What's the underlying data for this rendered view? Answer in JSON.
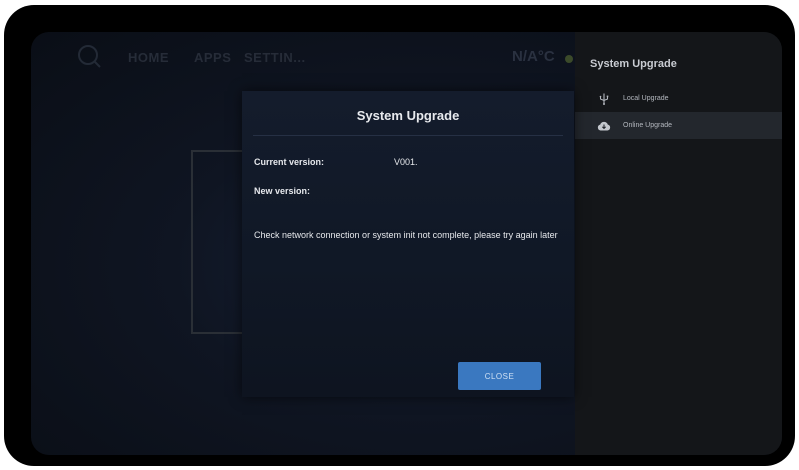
{
  "topbar": {
    "nav": [
      "HOME",
      "APPS",
      "SETTIN..."
    ],
    "temperature": "N/A°C"
  },
  "panel": {
    "title": "System Upgrade",
    "items": [
      {
        "label": "Local Upgrade",
        "icon": "usb-icon",
        "selected": false
      },
      {
        "label": "Online Upgrade",
        "icon": "cloud-download-icon",
        "selected": true
      }
    ]
  },
  "dialog": {
    "title": "System Upgrade",
    "current_version_label": "Current version:",
    "current_version_value": "V001.",
    "new_version_label": "New version:",
    "new_version_value": "",
    "message": "Check network connection or system init not complete, please try again later",
    "close_label": "CLOSE"
  },
  "colors": {
    "accent": "#3a78c0",
    "panel_bg": "#141619",
    "dialog_bg": "#121a29"
  }
}
